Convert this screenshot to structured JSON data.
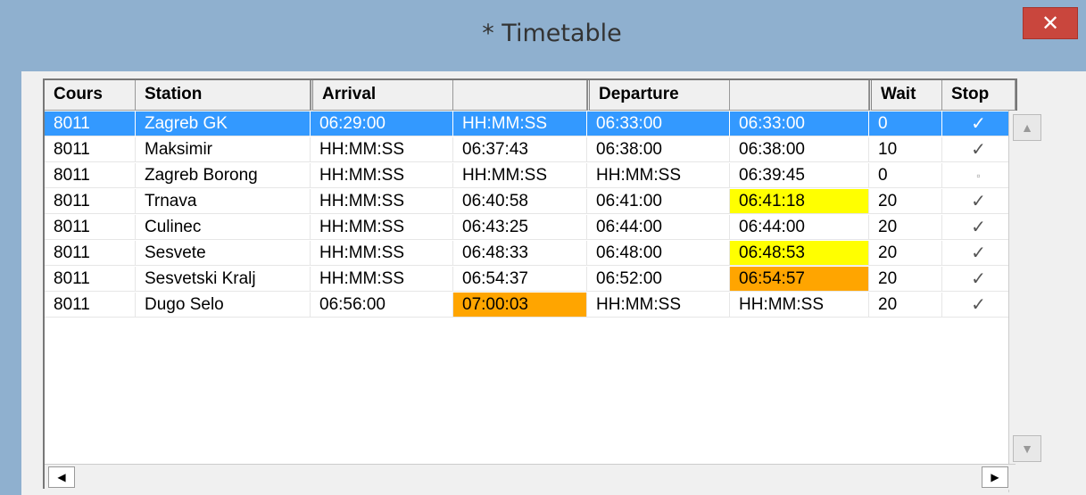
{
  "window": {
    "title": "* Timetable",
    "close_glyph": "✕"
  },
  "table": {
    "headers": [
      "Cours",
      "Station",
      "Arrival",
      "",
      "Departure",
      "",
      "Wait",
      "Stop"
    ],
    "rows": [
      [
        "8011",
        "Zagreb GK",
        "06:29:00",
        "HH:MM:SS",
        "06:33:00",
        "06:33:00",
        "0",
        "✓"
      ],
      [
        "8011",
        "Maksimir",
        "HH:MM:SS",
        "06:37:43",
        "06:38:00",
        "06:38:00",
        "10",
        "✓"
      ],
      [
        "8011",
        "Zagreb Borong",
        "HH:MM:SS",
        "HH:MM:SS",
        "HH:MM:SS",
        "06:39:45",
        "0",
        "▫"
      ],
      [
        "8011",
        "Trnava",
        "HH:MM:SS",
        "06:40:58",
        "06:41:00",
        "06:41:18",
        "20",
        "✓"
      ],
      [
        "8011",
        "Culinec",
        "HH:MM:SS",
        "06:43:25",
        "06:44:00",
        "06:44:00",
        "20",
        "✓"
      ],
      [
        "8011",
        "Sesvete",
        "HH:MM:SS",
        "06:48:33",
        "06:48:00",
        "06:48:53",
        "20",
        "✓"
      ],
      [
        "8011",
        "Sesvetski Kralj",
        "HH:MM:SS",
        "06:54:37",
        "06:52:00",
        "06:54:57",
        "20",
        "✓"
      ],
      [
        "8011",
        "Dugo Selo",
        "06:56:00",
        "07:00:03",
        "HH:MM:SS",
        "HH:MM:SS",
        "20",
        "✓"
      ]
    ],
    "selected_row": 0,
    "highlights": {
      "yellow": "#ffff00",
      "orange": "#ffa500",
      "selection": "#3399ff"
    }
  },
  "scroll": {
    "up": "▲",
    "down": "▼",
    "left": "◀",
    "right": "▶"
  }
}
